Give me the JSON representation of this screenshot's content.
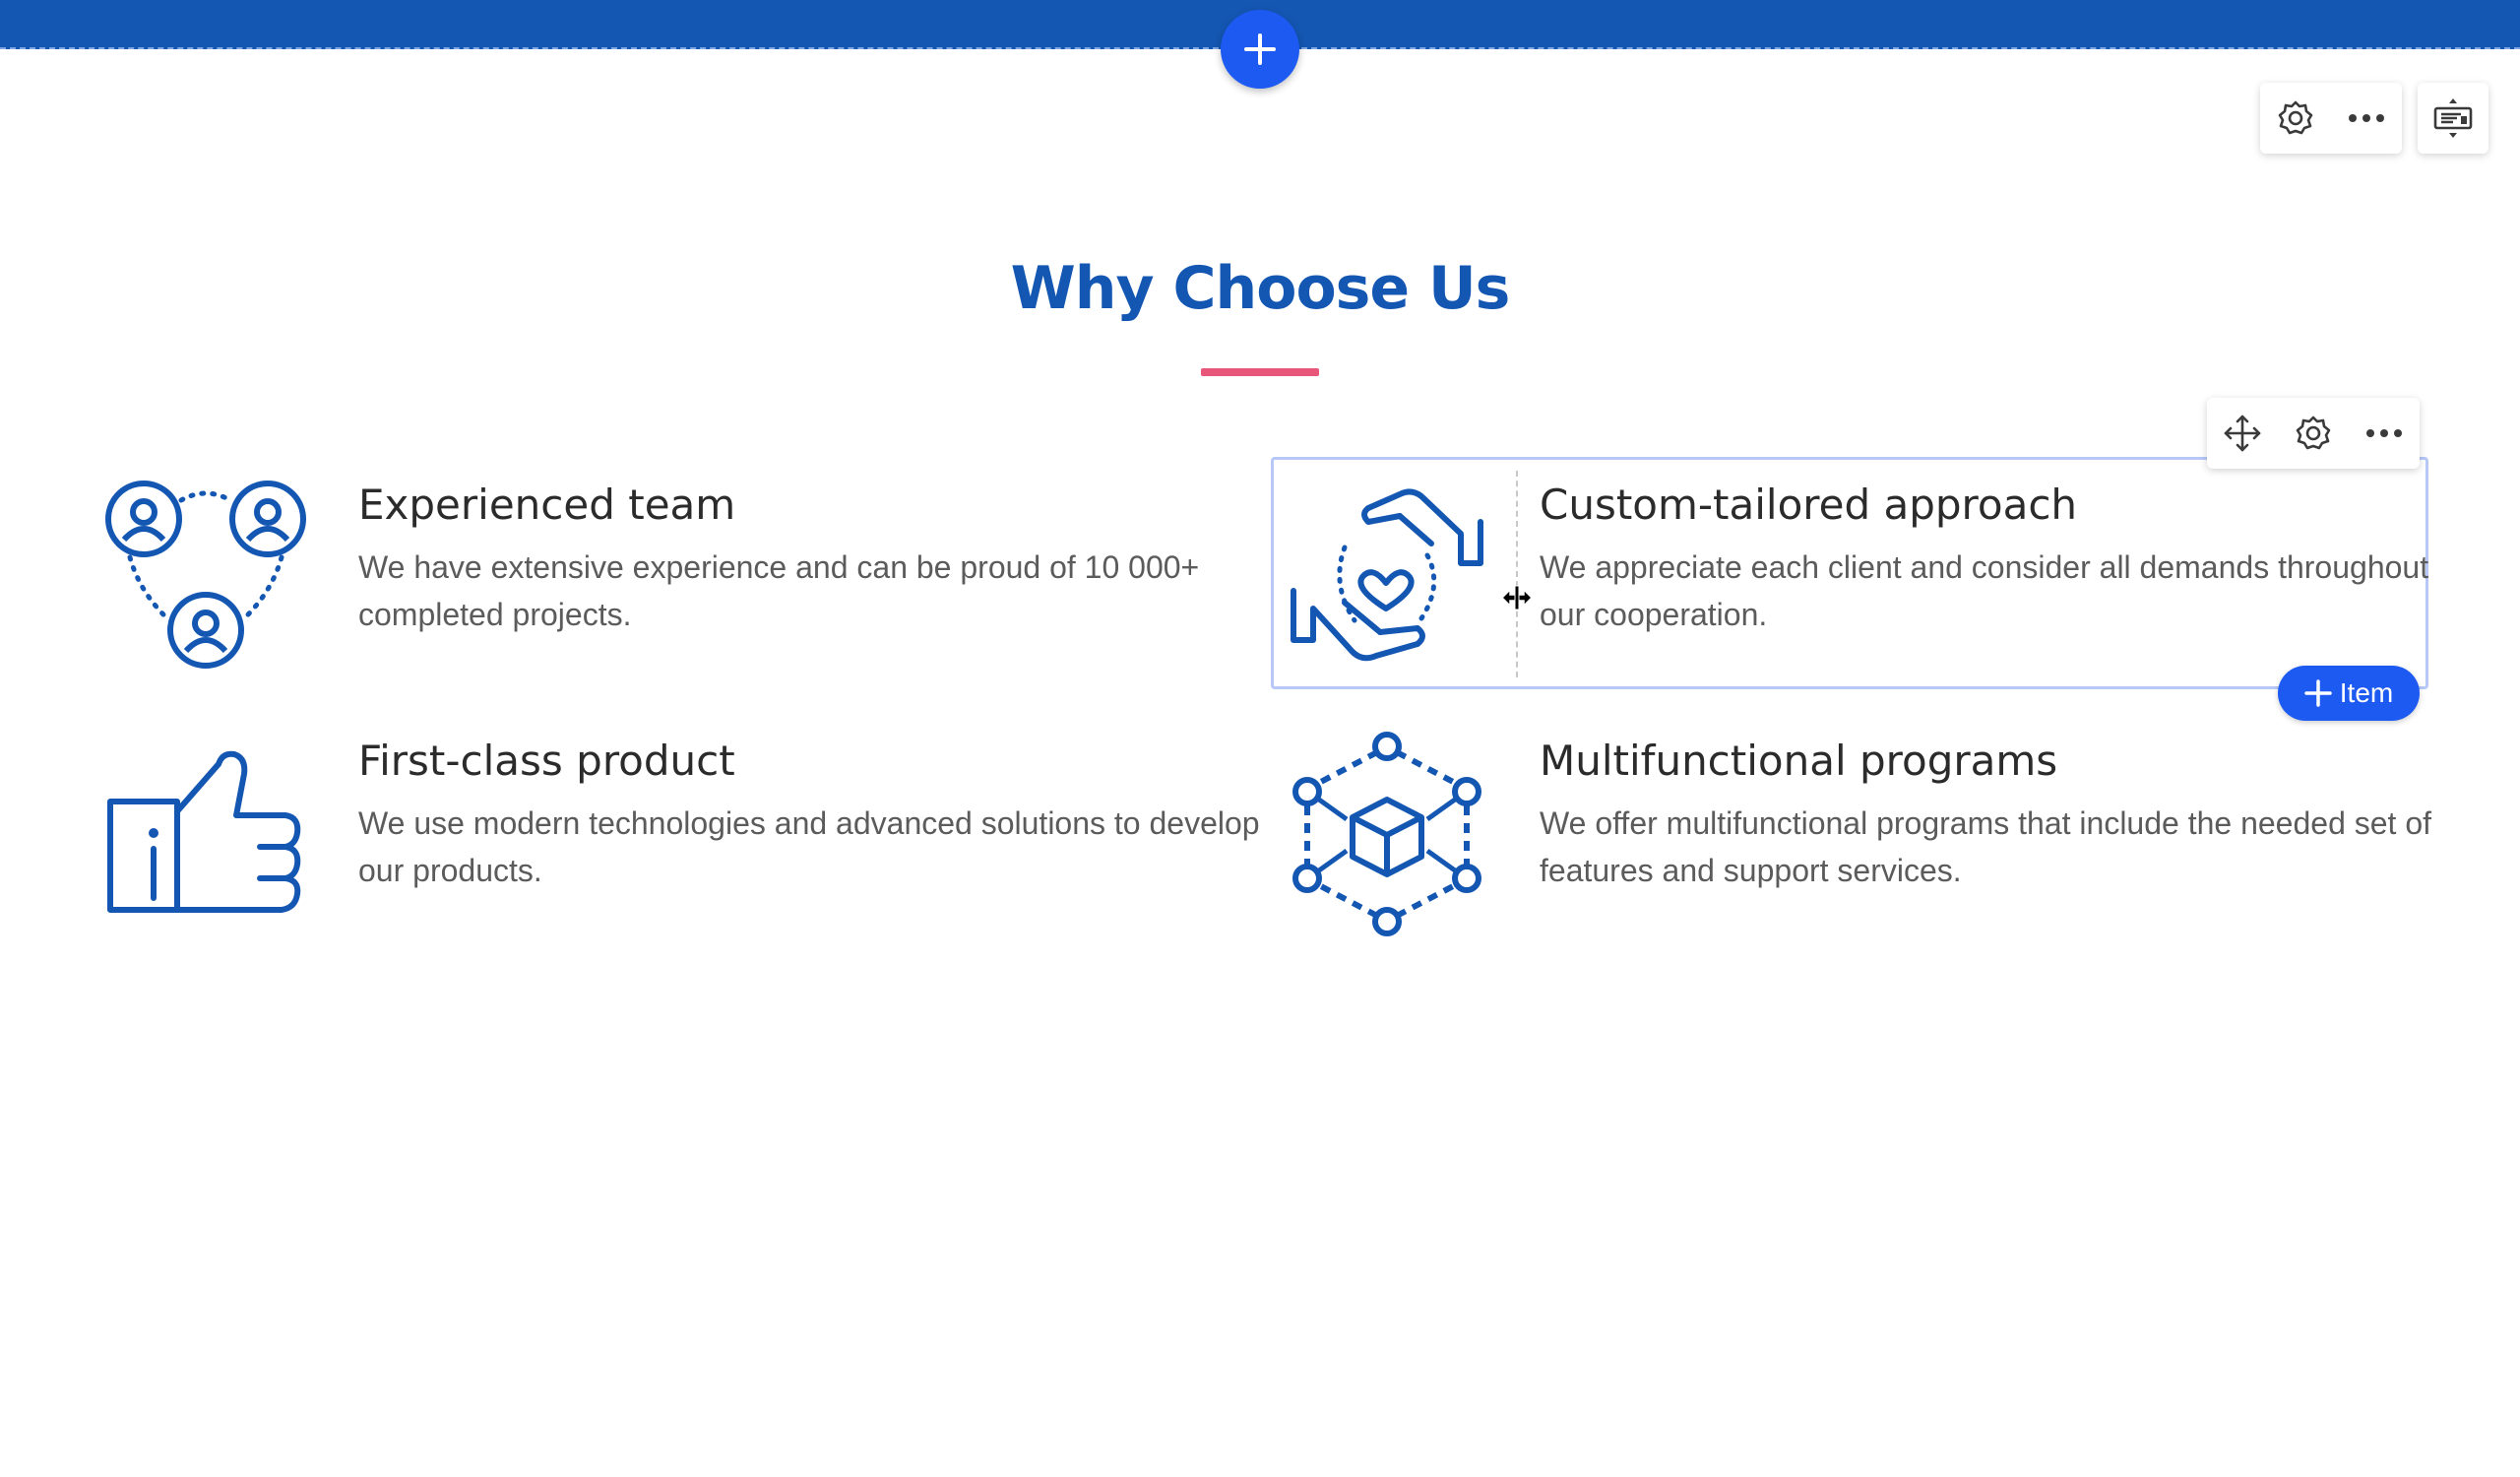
{
  "editor": {
    "add_section_icon": "plus-icon",
    "section_toolbar": [
      "gear-icon",
      "more-horizontal-icon"
    ],
    "layout_toolbar": [
      "layout-toggle-icon"
    ],
    "item_toolbar": [
      "move-icon",
      "gear-icon",
      "more-horizontal-icon"
    ],
    "add_item_label": "Item",
    "colors": {
      "top_bar": "#1457b3",
      "primary_button": "#1d5af2",
      "heading": "#1457b3",
      "accent_underline": "#e8577a",
      "selection_border": "#b7c8f7"
    }
  },
  "section": {
    "title": "Why Choose Us",
    "items": [
      {
        "icon": "team-network-icon",
        "title": "Experienced team",
        "description": "We have extensive experience and can be proud of 10 000+ completed projects."
      },
      {
        "icon": "hands-heart-icon",
        "title": "Custom-tailored approach",
        "description": "We appreciate each client and consider all demands throughout our cooperation."
      },
      {
        "icon": "thumbs-up-icon",
        "title": "First-class product",
        "description": "We use modern technologies and advanced solutions to develop our products."
      },
      {
        "icon": "cube-network-icon",
        "title": "Multifunctional programs",
        "description": "We offer multifunctional programs that include the needed set of features and support services."
      }
    ]
  }
}
